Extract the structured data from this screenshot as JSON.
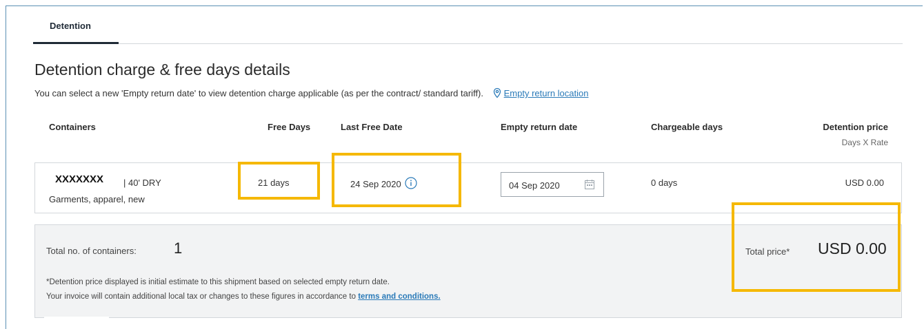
{
  "tabs": {
    "active": "Detention"
  },
  "header": {
    "title": "Detention charge & free days details",
    "subtitle": "You can select a new 'Empty return date' to view detention charge applicable (as per the contract/ standard tariff).",
    "location_link": "Empty return location"
  },
  "columns": {
    "containers": "Containers",
    "free_days": "Free Days",
    "last_free_date": "Last Free Date",
    "empty_return_date": "Empty return date",
    "chargeable_days": "Chargeable days",
    "detention_price": "Detention price",
    "detention_price_sub": "Days X Rate"
  },
  "row": {
    "container_id": "XXXXXXX",
    "container_type": "| 40' DRY",
    "commodity": "Garments, apparel, new",
    "free_days": "21 days",
    "last_free_date": "24 Sep 2020",
    "empty_return_date": "04 Sep 2020",
    "chargeable_days": "0 days",
    "detention_price": "USD 0.00"
  },
  "summary": {
    "total_containers_label": "Total no. of containers:",
    "total_containers": "1",
    "total_price_label": "Total price*",
    "total_price": "USD 0.00",
    "note_line1": "*Detention price displayed is initial estimate to this shipment based on selected empty return date.",
    "note_line2": "Your invoice will contain additional local tax or changes to these figures in accordance to",
    "terms_link": "terms and conditions."
  },
  "colors": {
    "highlight": "#f5b800",
    "link": "#2a7ab8",
    "summary_bg": "#f2f3f4"
  },
  "icons": [
    "location-pin-icon",
    "info-icon",
    "calendar-icon"
  ]
}
